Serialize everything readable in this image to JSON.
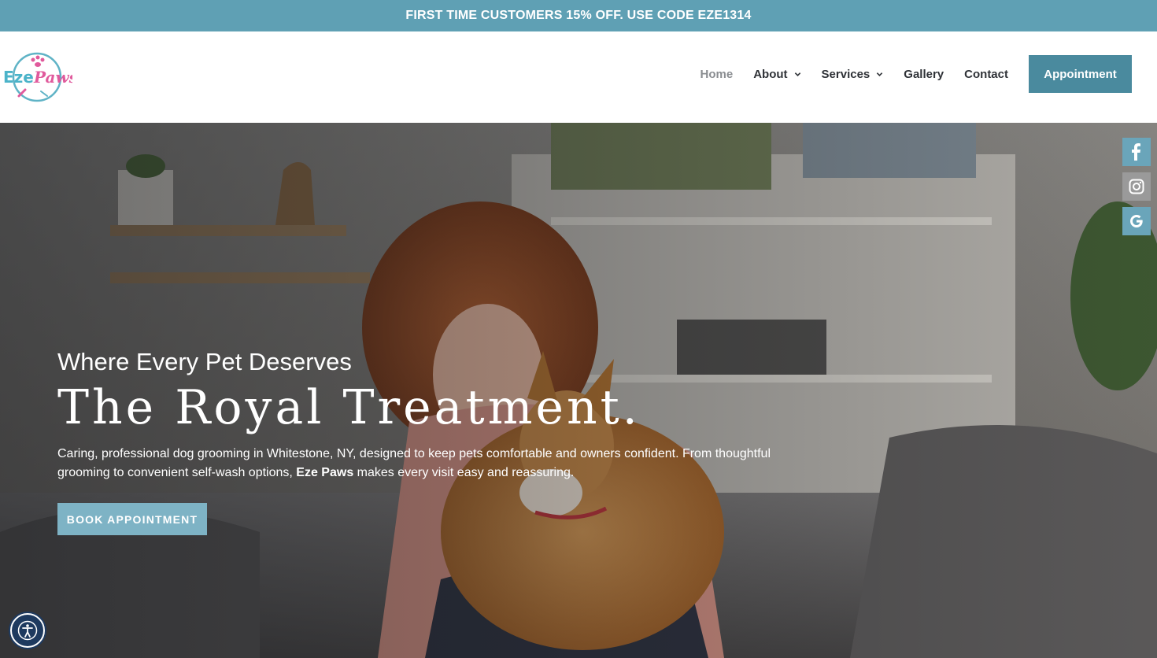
{
  "promo": {
    "text": "FIRST TIME CUSTOMERS 15% OFF. USE CODE EZE1314"
  },
  "brand": {
    "logo_text": "EzePaws",
    "accent": "#5fa0b4",
    "button": "#4a8a9e"
  },
  "nav": {
    "items": [
      {
        "label": "Home",
        "active": true,
        "has_dropdown": false
      },
      {
        "label": "About",
        "active": false,
        "has_dropdown": true
      },
      {
        "label": "Services",
        "active": false,
        "has_dropdown": true
      },
      {
        "label": "Gallery",
        "active": false,
        "has_dropdown": false
      },
      {
        "label": "Contact",
        "active": false,
        "has_dropdown": false
      }
    ],
    "cta": "Appointment"
  },
  "hero": {
    "kicker": "Where Every Pet Deserves",
    "title": "The Royal Treatment.",
    "desc_before": "Caring, professional dog grooming in Whitestone, NY, designed to keep pets comfortable and owners confident. From thoughtful grooming to convenient self-wash options, ",
    "desc_strong": "Eze Paws",
    "desc_after": " makes every visit easy and reassuring.",
    "cta": "BOOK APPOINTMENT"
  },
  "social": [
    {
      "name": "facebook-icon"
    },
    {
      "name": "instagram-icon"
    },
    {
      "name": "google-icon"
    }
  ]
}
